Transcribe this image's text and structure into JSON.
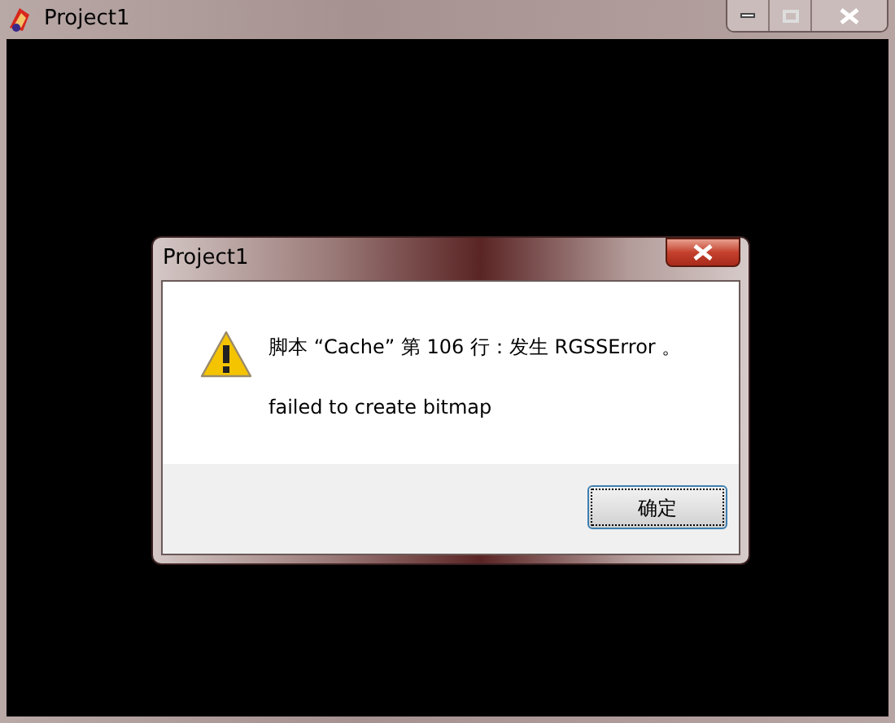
{
  "window": {
    "title": "Project1"
  },
  "dialog": {
    "title": "Project1",
    "message": "脚本 “Cache” 第 106 行：发生 RGSSError 。",
    "detail": "failed to create bitmap",
    "buttons": [
      "确定"
    ]
  }
}
